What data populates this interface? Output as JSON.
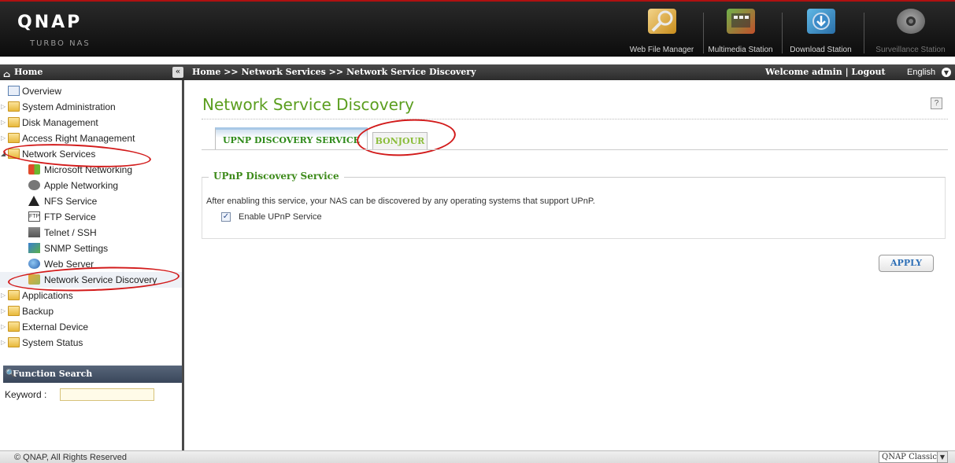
{
  "header": {
    "logo": "QNAP",
    "logo_sub": "TURBO NAS",
    "apps": [
      {
        "label": "Web File Manager",
        "icon": "web-file-manager-icon"
      },
      {
        "label": "Multimedia Station",
        "icon": "multimedia-station-icon"
      },
      {
        "label": "Download Station",
        "icon": "download-station-icon"
      },
      {
        "label": "Surveillance Station",
        "icon": "surveillance-station-icon"
      }
    ]
  },
  "bar": {
    "home": "Home",
    "breadcrumb": "Home >> Network Services >> Network Service Discovery",
    "welcome": "Welcome admin | Logout",
    "language": "English"
  },
  "sidebar": {
    "items": [
      {
        "label": "Overview",
        "level": 0
      },
      {
        "label": "System Administration",
        "level": 0
      },
      {
        "label": "Disk Management",
        "level": 0
      },
      {
        "label": "Access Right Management",
        "level": 0
      },
      {
        "label": "Network Services",
        "level": 0,
        "expanded": true
      },
      {
        "label": "Microsoft Networking",
        "level": 1
      },
      {
        "label": "Apple Networking",
        "level": 1
      },
      {
        "label": "NFS Service",
        "level": 1
      },
      {
        "label": "FTP Service",
        "level": 1
      },
      {
        "label": "Telnet / SSH",
        "level": 1
      },
      {
        "label": "SNMP Settings",
        "level": 1
      },
      {
        "label": "Web Server",
        "level": 1
      },
      {
        "label": "Network Service Discovery",
        "level": 1,
        "selected": true
      },
      {
        "label": "Applications",
        "level": 0
      },
      {
        "label": "Backup",
        "level": 0
      },
      {
        "label": "External Device",
        "level": 0
      },
      {
        "label": "System Status",
        "level": 0
      }
    ],
    "function_search": "Function Search",
    "keyword_label": "Keyword :"
  },
  "main": {
    "title": "Network Service Discovery",
    "tabs": [
      {
        "label": "UPNP DISCOVERY SERVICE",
        "active": true
      },
      {
        "label": "BONJOUR",
        "active": false
      }
    ],
    "section_title": "UPnP Discovery Service",
    "description": "After enabling this service, your NAS can be discovered by any operating systems that support UPnP.",
    "enable_label": "Enable UPnP Service",
    "enable_checked": true,
    "apply": "APPLY"
  },
  "footer": {
    "copyright": "© QNAP, All Rights Reserved",
    "theme": "QNAP Classic"
  },
  "colors": {
    "accent_green": "#5b9e1f",
    "annotation_red": "#d21a1a",
    "header_dark": "#111111"
  }
}
